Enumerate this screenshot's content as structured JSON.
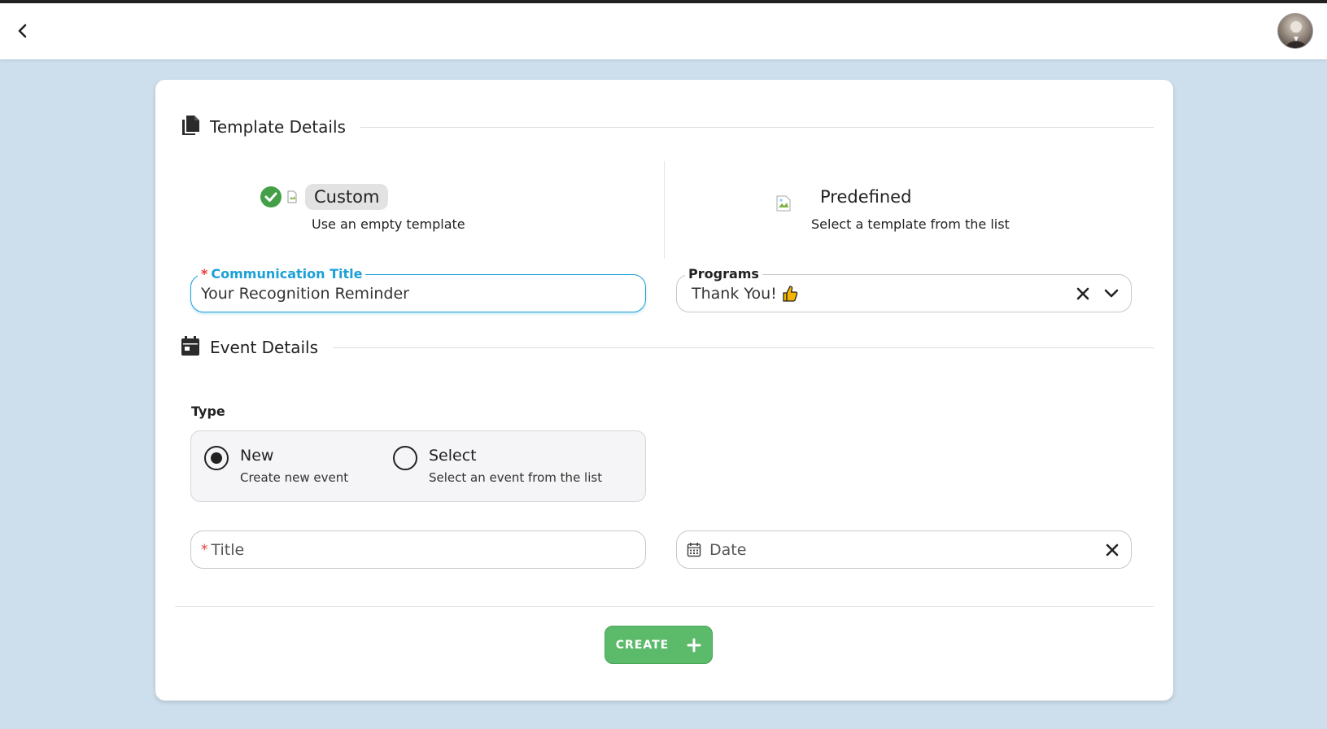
{
  "header": {
    "back_icon": "chevron-left-icon",
    "avatar_icon": "user-avatar"
  },
  "template_section": {
    "title": "Template Details",
    "icon": "documents-icon",
    "options": [
      {
        "label": "Custom",
        "description": "Use an empty template",
        "selected": true
      },
      {
        "label": "Predefined",
        "description": "Select a template from the list",
        "selected": false
      }
    ],
    "communication_title": {
      "label": "Communication Title",
      "required_mark": "*",
      "value": "Your Recognition Reminder"
    },
    "programs": {
      "label": "Programs",
      "value": "Thank You!"
    }
  },
  "event_section": {
    "title": "Event Details",
    "icon": "calendar-icon",
    "type_label": "Type",
    "types": [
      {
        "label": "New",
        "description": "Create new event",
        "selected": true
      },
      {
        "label": "Select",
        "description": "Select an event from the list",
        "selected": false
      }
    ],
    "title_field": {
      "placeholder": "Title",
      "required_mark": "*"
    },
    "date_field": {
      "placeholder": "Date"
    }
  },
  "actions": {
    "create_label": "CREATE"
  },
  "colors": {
    "accent": "#1da0d8",
    "success": "#5cba6b",
    "required": "#e53935",
    "background": "#cddfed"
  }
}
